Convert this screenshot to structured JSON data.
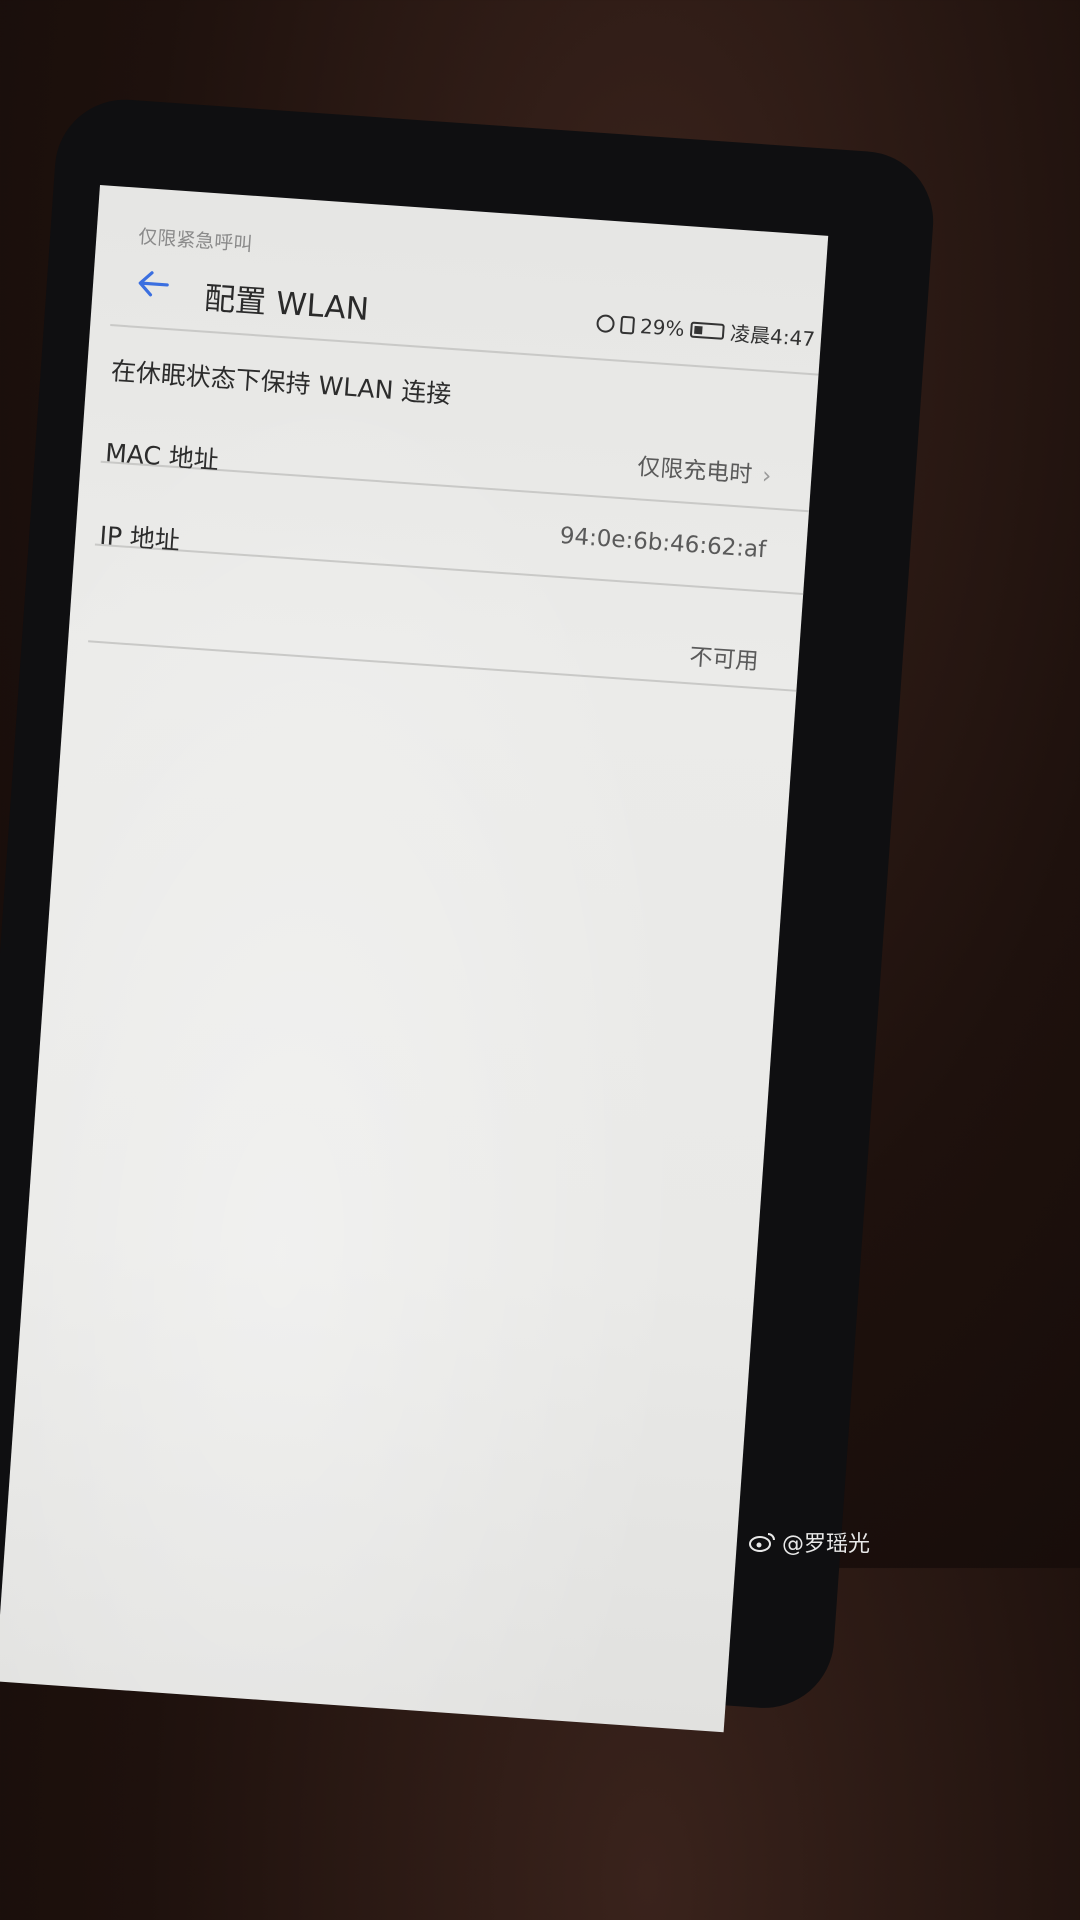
{
  "status_bar": {
    "emergency": "仅限紧急呼叫",
    "battery": "29%",
    "time": "凌晨4:47"
  },
  "header": {
    "title": "配置 WLAN"
  },
  "settings": {
    "keep_wlan": {
      "label": "在休眠状态下保持 WLAN 连接",
      "value": "仅限充电时"
    },
    "mac": {
      "label": "MAC 地址",
      "value": "94:0e:6b:46:62:af"
    },
    "ip": {
      "label": "IP 地址",
      "value": "不可用"
    }
  },
  "watermark": {
    "text": "@罗瑶光"
  },
  "colors": {
    "accent": "#3b6fe0"
  },
  "icons": [
    "back-arrow-icon",
    "alarm-icon",
    "vibrate-icon",
    "battery-icon",
    "chevron-right-icon",
    "weibo-icon"
  ]
}
